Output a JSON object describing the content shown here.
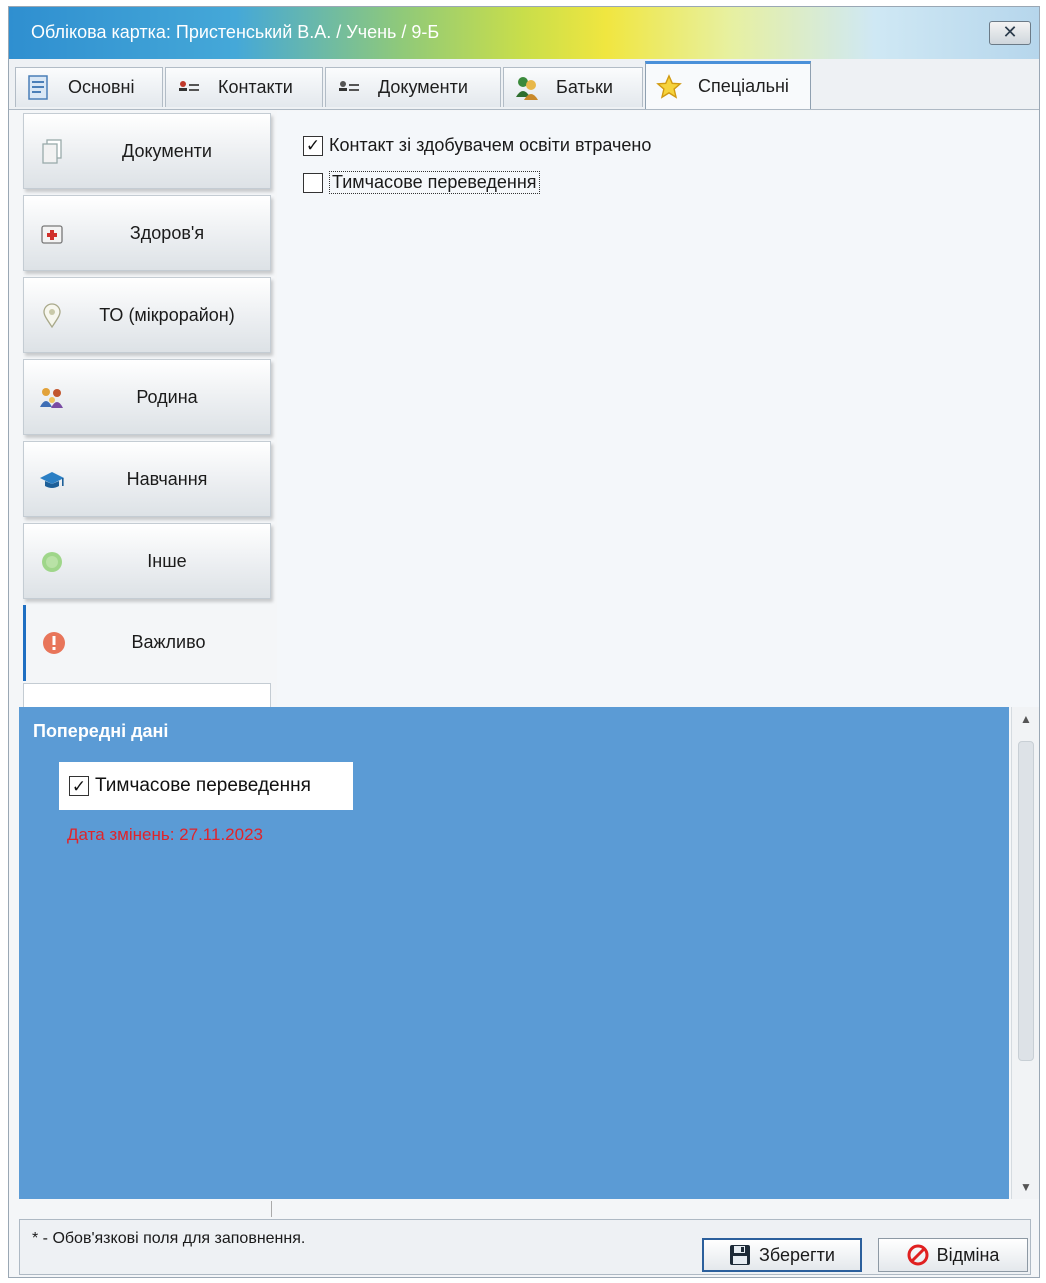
{
  "window": {
    "title": "Облікова картка: Пристенський В.А. / Учень / 9-Б",
    "close_glyph": "✕"
  },
  "tabs": [
    {
      "label": "Основні",
      "icon": "document-icon",
      "active": false
    },
    {
      "label": "Контакти",
      "icon": "contact-card-icon",
      "active": false
    },
    {
      "label": "Документи",
      "icon": "id-card-icon",
      "active": false
    },
    {
      "label": "Батьки",
      "icon": "parents-icon",
      "active": false
    },
    {
      "label": "Спеціальні",
      "icon": "star-icon",
      "active": true
    }
  ],
  "sidebar": {
    "items": [
      {
        "label": "Документи",
        "icon": "pages-icon",
        "active": false
      },
      {
        "label": "Здоров'я",
        "icon": "first-aid-icon",
        "active": false
      },
      {
        "label": "ТО (мікрорайон)",
        "icon": "map-pin-icon",
        "active": false
      },
      {
        "label": "Родина",
        "icon": "family-icon",
        "active": false
      },
      {
        "label": "Навчання",
        "icon": "graduation-cap-icon",
        "active": false
      },
      {
        "label": "Інше",
        "icon": "green-dot-icon",
        "active": false
      },
      {
        "label": "Важливо",
        "icon": "important-icon",
        "active": true
      }
    ]
  },
  "special": {
    "options": [
      {
        "label": "Контакт зі здобувачем освіти втрачено",
        "checked": true
      },
      {
        "label": "Тимчасове переведення",
        "checked": false
      }
    ]
  },
  "previous": {
    "title": "Попередні дані",
    "item_label": "Тимчасове переведення",
    "item_checked": true,
    "changed_date": "Дата змінень: 27.11.2023"
  },
  "footer": {
    "note": "* - Обов'язкові поля для заповнення.",
    "save_label": "Зберегти",
    "cancel_label": "Відміна"
  },
  "colors": {
    "panel_blue": "#5b9bd5",
    "date_red": "#e0242a",
    "active_accent": "#1f6fc2"
  }
}
